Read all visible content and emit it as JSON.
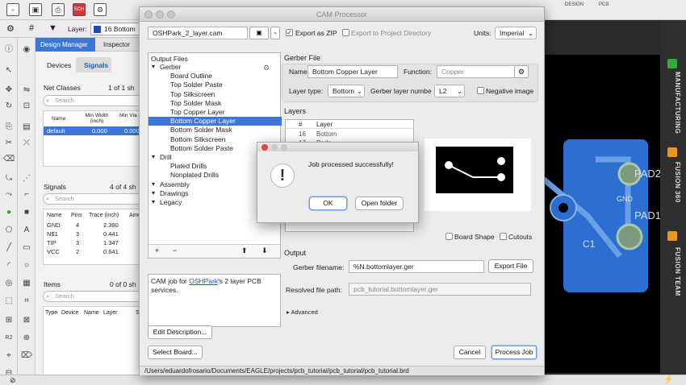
{
  "toolbar": {
    "layer_label": "Layer:",
    "layer_value": "16 Bottom",
    "design_label": "DESIGN",
    "pcb_label": "PCB"
  },
  "left_panel": {
    "tabs": [
      "Design Manager",
      "Inspector"
    ],
    "subtabs": [
      "Devices",
      "Signals"
    ],
    "net_classes": {
      "title": "Net Classes",
      "count": "1 of 1 sh",
      "search": "Search",
      "headers": [
        "Name",
        "Min Width (inch)",
        "Min Via (i"
      ],
      "rows": [
        [
          "default",
          "0.000",
          "0.000"
        ]
      ]
    },
    "signals": {
      "title": "Signals",
      "count": "4 of 4 sh",
      "search": "Search",
      "headers": [
        "Name",
        "Pins",
        "Trace (inch)",
        "Airwi"
      ],
      "rows": [
        [
          "GND",
          "4",
          "2.390"
        ],
        [
          "N$1",
          "3",
          "0.441"
        ],
        [
          "TIP",
          "3",
          "1.347"
        ],
        [
          "VCC",
          "2",
          "0.641"
        ]
      ]
    },
    "items": {
      "title": "Items",
      "count": "0 of 0 sh",
      "search": "Search",
      "headers": [
        "Type",
        "Device",
        "Name",
        "Layer",
        "Si"
      ]
    }
  },
  "right_sidebar": {
    "items": [
      "MANUFACTURING",
      "FUSION 360",
      "FUSION TEAM"
    ]
  },
  "board_labels": {
    "pad2": "PAD2",
    "pad1": "PAD1",
    "gnd": "GND",
    "c1": "C1"
  },
  "cam": {
    "title": "CAM Processor",
    "job_file": "OSHPark_2_layer.cam",
    "export_zip": "Export as ZIP",
    "export_project": "Export to Project Directory",
    "units_label": "Units:",
    "units_value": "Imperial",
    "output_files_title": "Output Files",
    "tree": [
      {
        "label": "Gerber",
        "level": 0
      },
      {
        "label": "Board Outline",
        "level": 1
      },
      {
        "label": "Top Solder Paste",
        "level": 1
      },
      {
        "label": "Top Silkscreen",
        "level": 1
      },
      {
        "label": "Top Solder Mask",
        "level": 1
      },
      {
        "label": "Top Copper Layer",
        "level": 1
      },
      {
        "label": "Bottom Copper Layer",
        "level": 1,
        "selected": true
      },
      {
        "label": "Bottom Solder Mask",
        "level": 1
      },
      {
        "label": "Bottom Silkscreen",
        "level": 1
      },
      {
        "label": "Bottom Solder Paste",
        "level": 1
      },
      {
        "label": "Drill",
        "level": 0
      },
      {
        "label": "Plated Drills",
        "level": 1
      },
      {
        "label": "Nonplated Drills",
        "level": 1
      },
      {
        "label": "Assembly",
        "level": 0
      },
      {
        "label": "Drawings",
        "level": 0
      },
      {
        "label": "Legacy",
        "level": 0
      }
    ],
    "description_pre": "CAM job for ",
    "description_link": "OSHPark",
    "description_post": "'s 2 layer PCB services.",
    "edit_description": "Edit Description...",
    "select_board": "Select Board...",
    "gerber_title": "Gerber File",
    "name_label": "Name:",
    "name_value": "Bottom Copper Layer",
    "function_label": "Function:",
    "function_value": "Copper",
    "layer_type_label": "Layer type:",
    "layer_type_value": "Bottom",
    "gerber_layer_label": "Gerber layer numbe",
    "gerber_layer_value": "L2",
    "negative_image": "Negative image",
    "layers_title": "Layers",
    "layers_headers": [
      "#",
      "Layer"
    ],
    "layers_rows": [
      [
        "16",
        "Bottom"
      ],
      [
        "17",
        "Pads"
      ]
    ],
    "board_shape": "Board Shape",
    "cutouts": "Cutouts",
    "output_title": "Output",
    "gerber_filename_label": "Gerber filename:",
    "gerber_filename_value": "%N.bottomlayer.ger",
    "export_file": "Export File",
    "resolved_label": "Resolved file path:",
    "resolved_value": "pcb_tutorial.bottomlayer.ger",
    "advanced": "Advanced",
    "cancel": "Cancel",
    "process_job": "Process Job",
    "path": "/Users/eduardofrosario/Documents/EAGLE/projects/pcb_tutorial/pcb_tutorial/pcb_tutorial.brd"
  },
  "alert": {
    "message": "Job processed successfully!",
    "ok": "OK",
    "open_folder": "Open folder"
  }
}
